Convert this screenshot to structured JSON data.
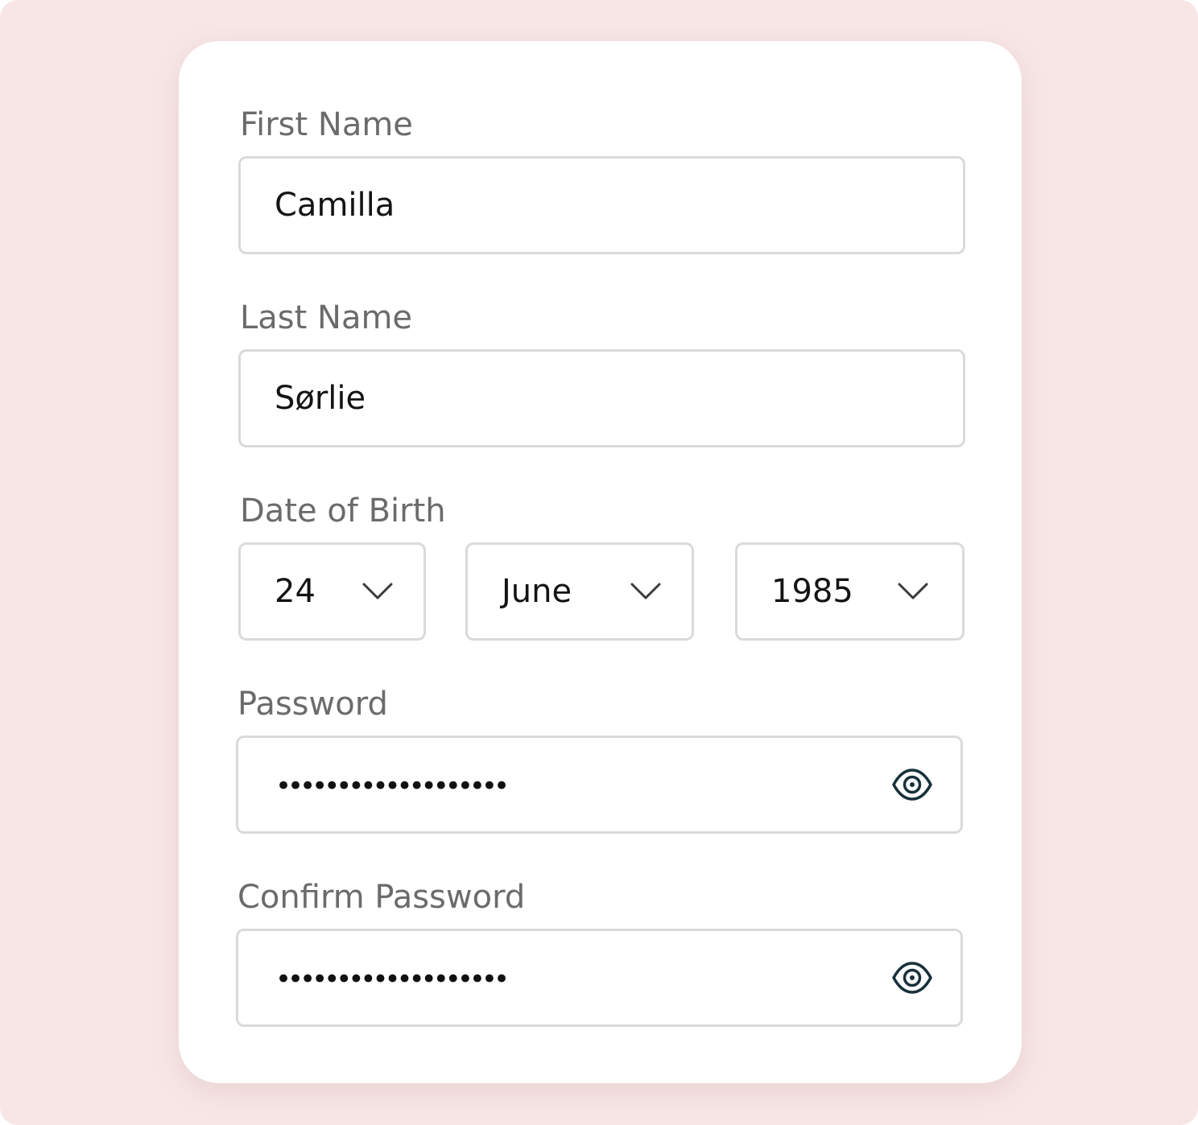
{
  "form": {
    "first_name": {
      "label": "First Name",
      "value": "Camilla"
    },
    "last_name": {
      "label": "Last Name",
      "value": "Sørlie"
    },
    "date_of_birth": {
      "label": "Date of Birth",
      "day": "24",
      "month": "June",
      "year": "1985"
    },
    "password": {
      "label": "Password",
      "masked_value": "•••••••••••••••••••",
      "toggle_icon": "eye-icon"
    },
    "confirm_password": {
      "label": "Confirm Password",
      "masked_value": "•••••••••••••••••••",
      "toggle_icon": "eye-icon"
    }
  },
  "colors": {
    "background": "#f8e6e6",
    "card": "#ffffff",
    "label_text": "#6b6b6b",
    "value_text": "#141414",
    "field_border": "#dadada",
    "icon": "#17313a"
  }
}
